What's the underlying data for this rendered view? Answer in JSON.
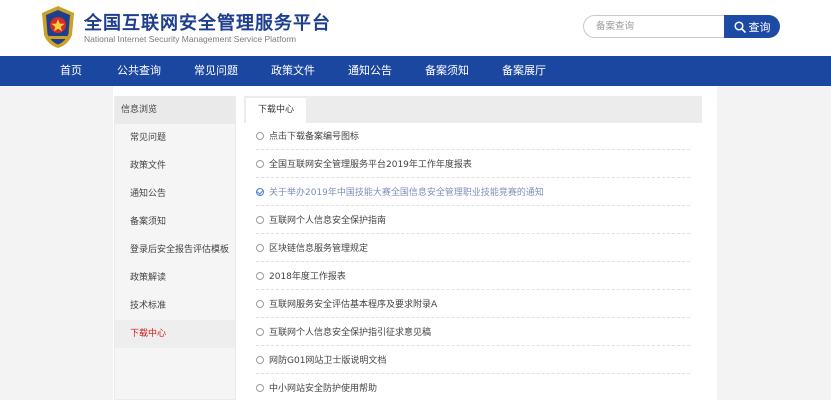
{
  "header": {
    "title": "全国互联网安全管理服务平台",
    "subtitle": "National Internet Security Management Service Platform",
    "search_placeholder": "备案查询",
    "search_button": "查询"
  },
  "nav": {
    "items": [
      "首页",
      "公共查询",
      "常见问题",
      "政策文件",
      "通知公告",
      "备案须知",
      "备案展厅"
    ]
  },
  "sidebar": {
    "heading": "信息浏览",
    "items": [
      "常见问题",
      "政策文件",
      "通知公告",
      "备案须知",
      "登录后安全报告评估模板",
      "政策解读",
      "技术标准",
      "下载中心"
    ],
    "active_index": 7,
    "active_color": "#d11a1a"
  },
  "main": {
    "tab": "下载中心",
    "documents": [
      {
        "title": "点击下载备案编号图标",
        "selected": false
      },
      {
        "title": "全国互联网安全管理服务平台2019年工作年度报表",
        "selected": false
      },
      {
        "title": "关于举办2019年中国技能大赛全国信息安全管理职业技能竞赛的通知",
        "selected": true
      },
      {
        "title": "互联网个人信息安全保护指南",
        "selected": false
      },
      {
        "title": "区块链信息服务管理规定",
        "selected": false
      },
      {
        "title": "2018年度工作报表",
        "selected": false
      },
      {
        "title": "互联网服务安全评估基本程序及要求附录A",
        "selected": false
      },
      {
        "title": "互联网个人信息安全保护指引征求意见稿",
        "selected": false
      },
      {
        "title": "网防G01网站卫士版说明文档",
        "selected": false
      },
      {
        "title": "中小网站安全防护使用帮助",
        "selected": false
      }
    ]
  },
  "colors": {
    "brand_blue": "#1c47a1",
    "title_blue": "#1d3f8e"
  }
}
